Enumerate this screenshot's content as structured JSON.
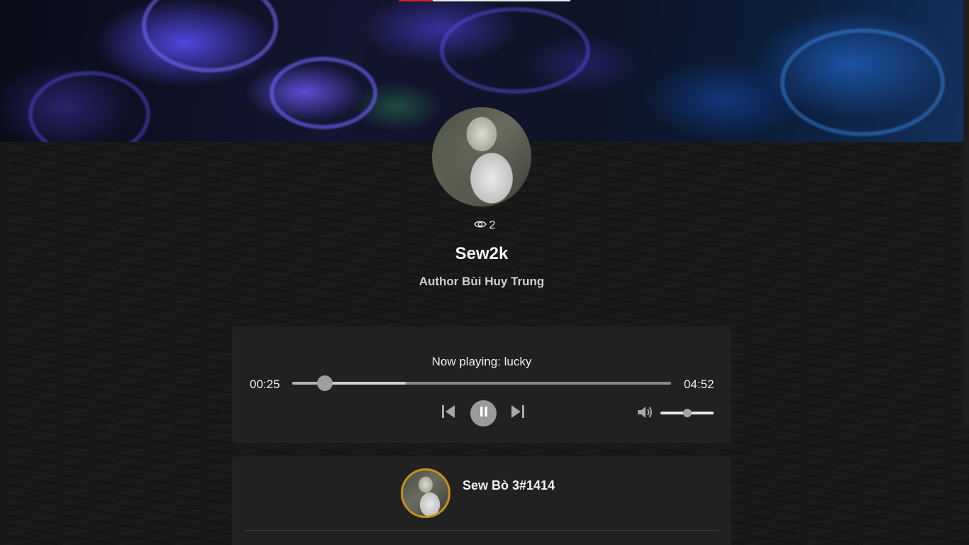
{
  "profile": {
    "views_count": "2",
    "title": "Sew2k",
    "author_line": "Author Bùi Huy Trung"
  },
  "player": {
    "now_playing": "Now playing: lucky",
    "current_time": "00:25",
    "total_time": "04:52",
    "progress_fraction": 0.0856,
    "buffered_fraction": 0.3,
    "volume_fraction": 0.5
  },
  "discord": {
    "username": "Sew Bò 3#1414",
    "avatar_ring_color": "#c8901a"
  },
  "colors": {
    "page_bg": "#191919",
    "card_bg": "#212121",
    "accent_red": "#d21f2b"
  },
  "icons": {
    "views": "eye-icon",
    "prev": "skip-previous-icon",
    "play_state": "pause-icon",
    "next": "skip-next-icon",
    "volume": "volume-icon"
  }
}
